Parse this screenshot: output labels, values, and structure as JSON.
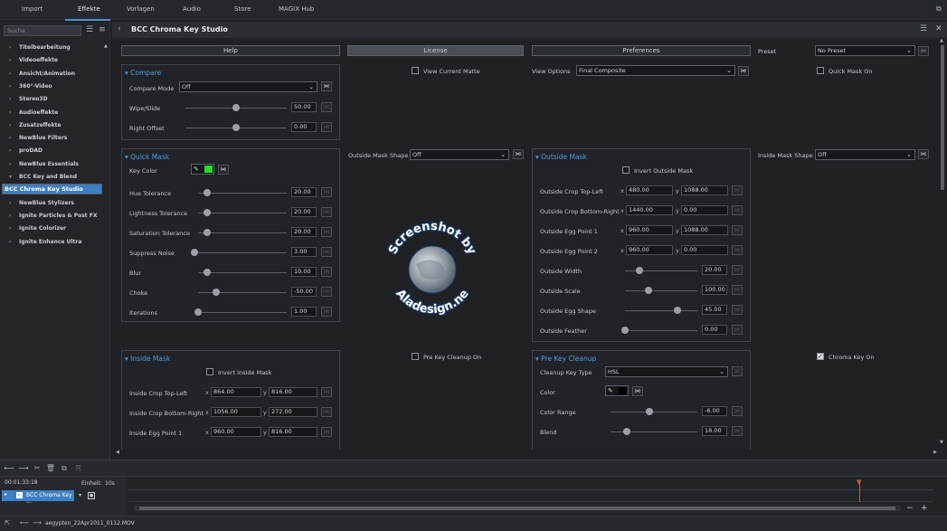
{
  "tabs": [
    "Import",
    "Effekte",
    "Vorlagen",
    "Audio",
    "Store",
    "MAGIX Hub"
  ],
  "search_placeholder": "Suche",
  "sidebar": [
    "Titelbearbeitung",
    "Videoeffekte",
    "Ansicht/Animation",
    "360°-Video",
    "Stereo3D",
    "Audioeffekte",
    "Zusatzeffekte",
    "NewBlue Filters",
    "proDAD",
    "NewBlue Essentials",
    "BCC Key and Blend",
    "BCC Chroma Key Studio",
    "NewBlue Stylizers",
    "Ignite Particles & Post FX",
    "Ignite Colorizer",
    "Ignite Enhance Ultra"
  ],
  "title": "BCC Chroma Key Studio",
  "top_buttons": {
    "help": "Help",
    "license": "License",
    "preferences": "Preferences",
    "preset_label": "Preset",
    "preset_value": "No Preset"
  },
  "view": {
    "view_current_matte": "View Current Matte",
    "view_options_label": "View Options",
    "view_options_value": "Final Composite",
    "quick_mask_on": "Quick Mask On"
  },
  "compare": {
    "header": "Compare",
    "mode_label": "Compare Mode",
    "mode_value": "Off",
    "wipe_label": "Wipe/Slide",
    "wipe_value": "50.00",
    "offset_label": "Right Offset",
    "offset_value": "0.00"
  },
  "quick_mask": {
    "header": "Quick Mask",
    "key_color_label": "Key Color",
    "key_color": "#22dd22",
    "rows": [
      {
        "label": "Hue Tolerance",
        "value": "20.00"
      },
      {
        "label": "Lightness Tolerance",
        "value": "20.00"
      },
      {
        "label": "Saturation Tolerance",
        "value": "20.00"
      },
      {
        "label": "Suppress Noise",
        "value": "3.00"
      },
      {
        "label": "Blur",
        "value": "10.00"
      },
      {
        "label": "Choke",
        "value": "-50.00"
      },
      {
        "label": "Iterations",
        "value": "1.00"
      }
    ]
  },
  "outside_mask_shape": {
    "label": "Outside Mask Shape",
    "value": "Off"
  },
  "inside_mask_shape": {
    "label": "Inside Mask Shape",
    "value": "Off"
  },
  "outside_mask": {
    "header": "Outside Mask",
    "invert": "Invert Outside Mask",
    "points": [
      {
        "label": "Outside Crop Top-Left",
        "x": "480.00",
        "y": "1088.00"
      },
      {
        "label": "Outside Crop Bottom-Right",
        "x": "1440.00",
        "y": "0.00"
      },
      {
        "label": "Outside Egg Point 1",
        "x": "960.00",
        "y": "1088.00"
      },
      {
        "label": "Outside Egg Point 2",
        "x": "960.00",
        "y": "0.00"
      }
    ],
    "sliders": [
      {
        "label": "Outside Width",
        "value": "20.00"
      },
      {
        "label": "Outside Scale",
        "value": "100.00"
      },
      {
        "label": "Outside Egg Shape",
        "value": "45.00"
      },
      {
        "label": "Outside Feather",
        "value": "0.00"
      }
    ]
  },
  "inside_mask": {
    "header": "Inside Mask",
    "invert": "Invert Inside Mask",
    "points": [
      {
        "label": "Inside Crop Top-Left",
        "x": "864.00",
        "y": "816.00"
      },
      {
        "label": "Inside Crop Bottom-Right",
        "x": "1056.00",
        "y": "272.00"
      },
      {
        "label": "Inside Egg Point 1",
        "x": "960.00",
        "y": "816.00"
      }
    ]
  },
  "pre_key_cleanup_on": "Pre Key Cleanup On",
  "chroma_key_on": "Chroma Key On",
  "pre_key": {
    "header": "Pre Key Cleanup",
    "type_label": "Cleanup Key Type",
    "type_value": "HSL",
    "color_label": "Color",
    "range_label": "Color Range",
    "range_value": "-6.00",
    "blend_label": "Blend",
    "blend_value": "18.00"
  },
  "timeline": {
    "timecode": "00:01:33:18",
    "unit_label": "Einheit:",
    "unit_value": "10s",
    "track_name": "BCC Chroma Key ..."
  },
  "status_file": "aegypten_22Apr2011_0112.MOV",
  "watermark": {
    "line1": "Screenshot by",
    "line2": "Aladesign.ne"
  }
}
